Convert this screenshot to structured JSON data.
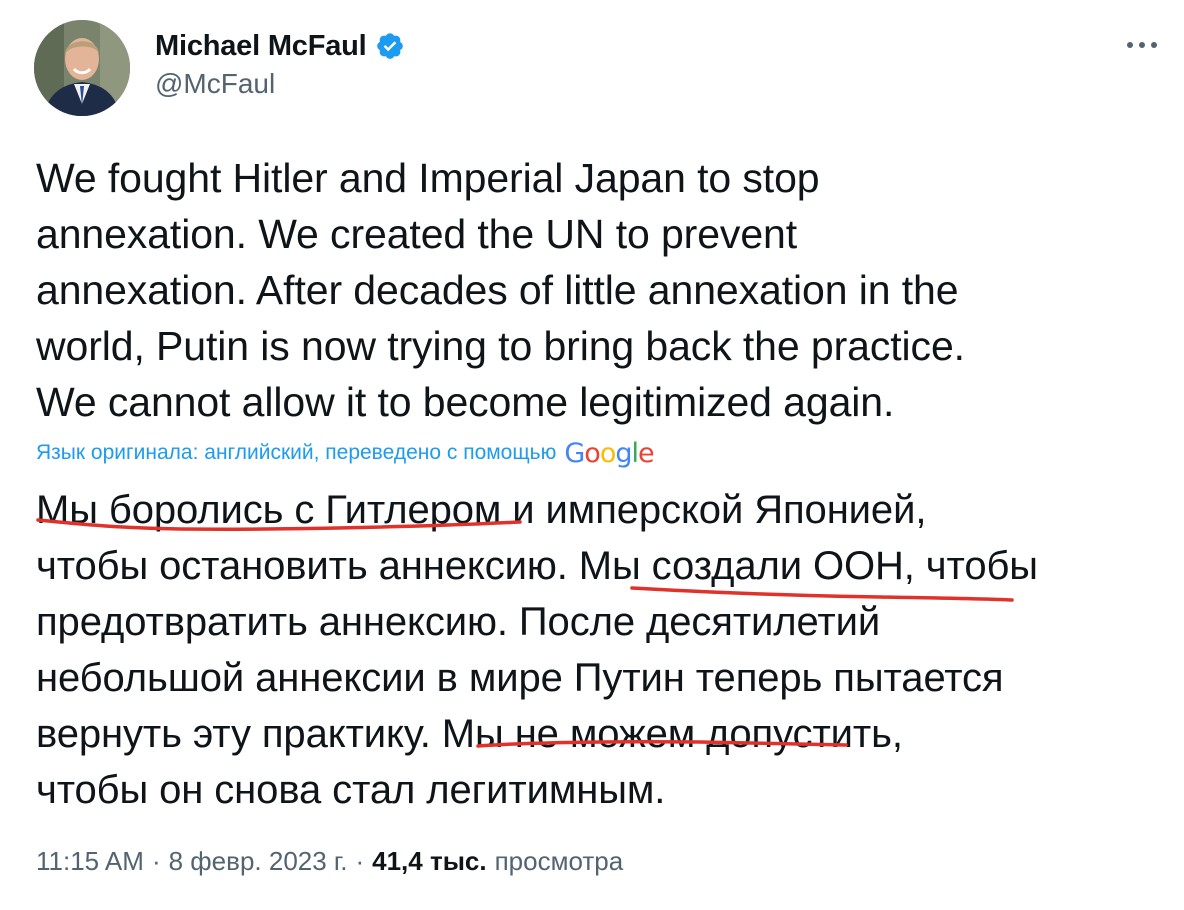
{
  "author": {
    "display_name": "Michael McFaul",
    "handle": "@McFaul",
    "verified": true,
    "avatar_icon": "profile-photo"
  },
  "menu": {
    "icon": "more-horizontal-icon"
  },
  "tweet": {
    "original_text": "We fought Hitler and Imperial Japan to stop\nannexation. We created the UN to prevent\nannexation.  After decades of little annexation in the\nworld, Putin is now trying to bring back the practice.\nWe cannot allow it to become legitimized again.",
    "translation_note": "Язык оригинала: английский, переведено с помощью",
    "translation_provider": "Google",
    "translated_text": "Мы боролись с Гитлером и имперской Японией,\nчтобы остановить аннексию. Мы создали ООН, чтобы\nпредотвратить аннексию. После десятилетий\nнебольшой аннексии в мире Путин теперь пытается\nвернуть эту практику. Мы не можем допустить,\nчтобы он снова стал легитимным."
  },
  "meta": {
    "time": "11:15 AM",
    "date": "8 февр. 2023 г.",
    "views_count": "41,4 тыс.",
    "views_label": "просмотра"
  },
  "colors": {
    "text": "#0f1419",
    "secondary": "#536471",
    "link": "#1d9bf0",
    "verified": "#1d9bf0",
    "annotation": "#e0322a"
  }
}
